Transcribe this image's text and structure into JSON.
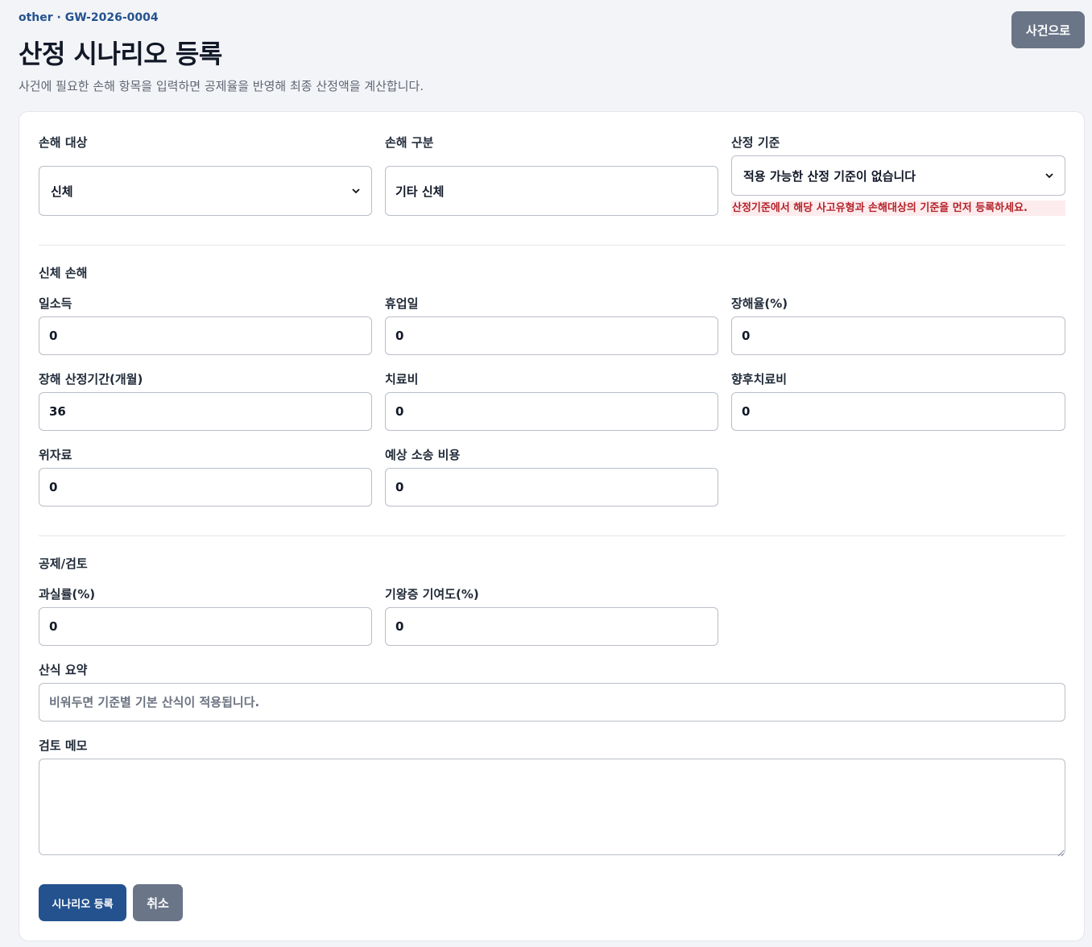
{
  "header": {
    "case_ref": "other · GW-2026-0004",
    "title": "산정 시나리오 등록",
    "description": "사건에 필요한 손해 항목을 입력하면 공제율을 반영해 최종 산정액을 계산합니다.",
    "back_label": "사건으로"
  },
  "top": {
    "damage_target": {
      "label": "손해 대상",
      "value": "신체"
    },
    "damage_category": {
      "label": "손해 구분",
      "value": "기타 신체"
    },
    "criteria": {
      "label": "산정 기준",
      "value": "적용 가능한 산정 기준이 없습니다",
      "error": "산정기준에서 해당 사고유형과 손해대상의 기준을 먼저 등록하세요."
    }
  },
  "bodily": {
    "section_title": "신체 손해",
    "daily_income": {
      "label": "일소득",
      "value": "0"
    },
    "lost_days": {
      "label": "휴업일",
      "value": "0"
    },
    "disability_rate": {
      "label": "장해율(%)",
      "value": "0"
    },
    "disability_months": {
      "label": "장해 산정기간(개월)",
      "value": "36"
    },
    "treatment_cost": {
      "label": "치료비",
      "value": "0"
    },
    "future_treatment": {
      "label": "향후치료비",
      "value": "0"
    },
    "consolation": {
      "label": "위자료",
      "value": "0"
    },
    "litigation_cost": {
      "label": "예상 소송 비용",
      "value": "0"
    }
  },
  "deduction": {
    "section_title": "공제/검토",
    "fault_rate": {
      "label": "과실률(%)",
      "value": "0"
    },
    "preexisting": {
      "label": "기왕증 기여도(%)",
      "value": "0"
    },
    "formula": {
      "label": "산식 요약",
      "value": "",
      "placeholder": "비워두면 기준별 기본 산식이 적용됩니다."
    },
    "memo": {
      "label": "검토 메모",
      "value": ""
    }
  },
  "actions": {
    "submit_label": "시나리오 등록",
    "cancel_label": "취소"
  },
  "colors": {
    "primary": "#24528f",
    "secondary": "#6b7588",
    "error_text": "#b4232a",
    "error_bg": "#fdecee"
  }
}
